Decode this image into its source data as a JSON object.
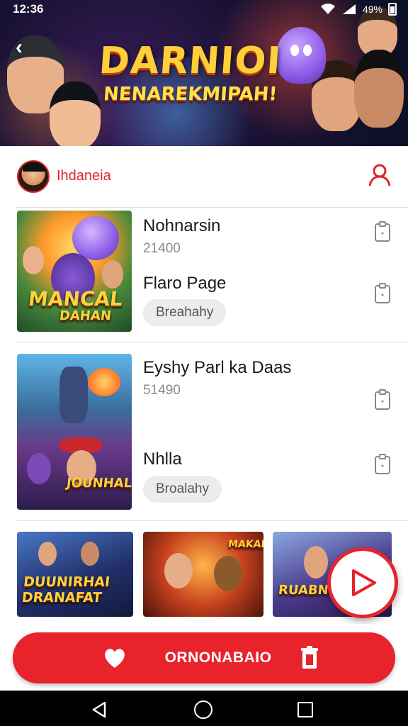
{
  "status_bar": {
    "time": "12:36",
    "battery_text": "49%"
  },
  "hero": {
    "title_line1": "DARNIOI",
    "title_line2": "NENAREKMIPAH!"
  },
  "profile": {
    "name": "Ihdaneia"
  },
  "list": [
    {
      "title": "Nohnarsin",
      "count": "21400",
      "subtitle": "Flaro Page",
      "chip": "Breahahy",
      "thumb_text_1": "MANCAL",
      "thumb_text_2": "DAHAN"
    },
    {
      "title": "Eyshy Parl ka Daas",
      "count": "51490",
      "subtitle": "Nhlla",
      "chip": "Broalahy",
      "thumb_text_1": "JOUNHAL",
      "thumb_text_2": ""
    }
  ],
  "grid": [
    {
      "title": "DUUNIRHAI DRANAFAT"
    },
    {
      "title": "MAKAR"
    },
    {
      "title": "RUABNIK"
    }
  ],
  "action_bar": {
    "label": "ORNONABAIO"
  },
  "colors": {
    "accent": "#e8232c",
    "background": "#ffffff",
    "navbar": "#000000"
  },
  "icons": {
    "back": "back-arrow-icon",
    "user": "user-icon",
    "clip": "clipboard-icon",
    "play": "play-icon",
    "heart": "heart-icon",
    "trash": "trash-icon"
  }
}
